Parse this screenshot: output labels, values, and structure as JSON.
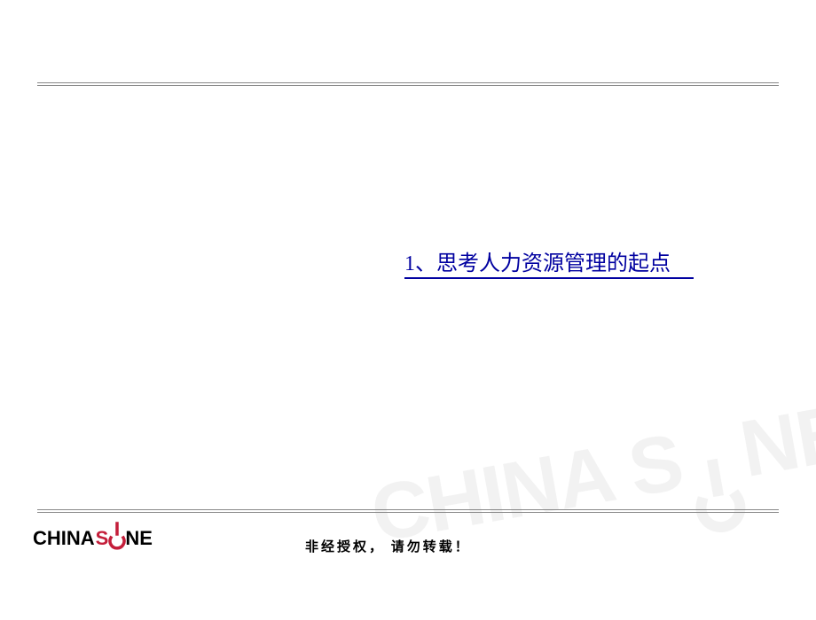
{
  "title": "1、思考人力资源管理的起点",
  "footer": "非经授权， 请勿转载！",
  "logo": {
    "part1": "CHINA",
    "part2": "S",
    "part3": "NE"
  },
  "watermark": {
    "part1": "CHINA S",
    "part2": "NE"
  }
}
